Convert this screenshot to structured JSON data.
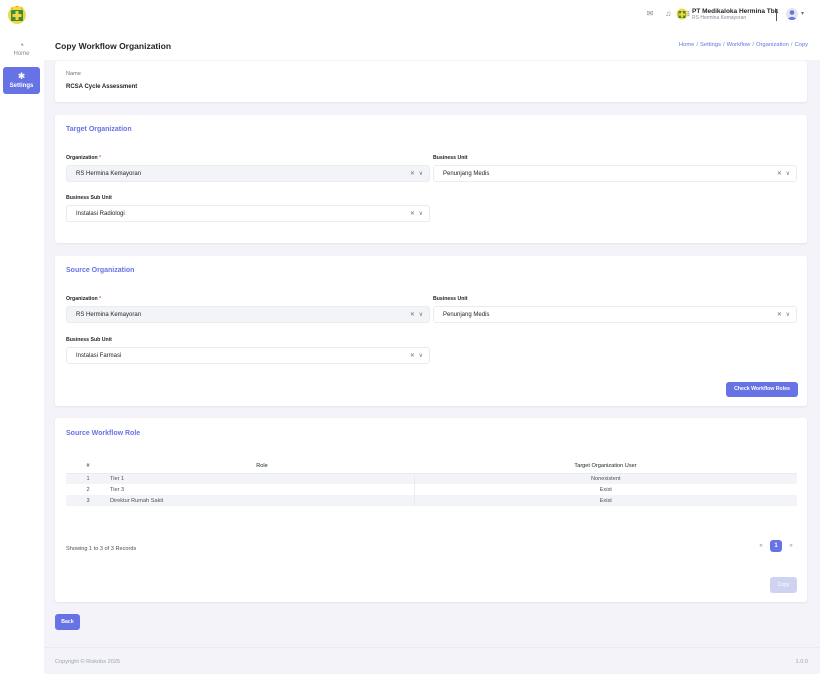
{
  "header": {
    "company_name": "PT Medikaloka Hermina Tbk",
    "company_sub": "RS Hermina Kemayoran",
    "icons": [
      "mail-icon",
      "bell-icon",
      "apps-grid-icon"
    ]
  },
  "sidebar": {
    "items": [
      {
        "label": "Home",
        "icon": "dashboard-icon"
      },
      {
        "label": "Settings",
        "icon": "gear-icon"
      }
    ]
  },
  "page": {
    "title": "Copy Workflow Organization",
    "breadcrumb": [
      "Home",
      "Settings",
      "Workflow",
      "Organization",
      "Copy"
    ]
  },
  "name_card": {
    "label": "Name",
    "value": "RCSA Cycle Assessment"
  },
  "target": {
    "title": "Target Organization",
    "organization_label": "Organization",
    "organization_value": "RS Hermina Kemayoran",
    "business_unit_label": "Business Unit",
    "business_unit_value": "Penunjang Medis",
    "sub_unit_label": "Business Sub Unit",
    "sub_unit_value": "Instalasi Radiologi"
  },
  "source": {
    "title": "Source Organization",
    "organization_label": "Organization",
    "organization_value": "RS Hermina Kemayoran",
    "business_unit_label": "Business Unit",
    "business_unit_value": "Penunjang Medis",
    "sub_unit_label": "Business Sub Unit",
    "sub_unit_value": "Instalasi Farmasi",
    "check_button": "Check Workflow Roles"
  },
  "roles": {
    "title": "Source Workflow Role",
    "columns": [
      "#",
      "Role",
      "Target Organization User"
    ],
    "rows": [
      {
        "num": "1",
        "role": "Tier 1",
        "status": "Nonexistent"
      },
      {
        "num": "2",
        "role": "Tier 3",
        "status": "Exist"
      },
      {
        "num": "3",
        "role": "Direktur Rumah Sakit",
        "status": "Exist"
      }
    ],
    "records_text": "Showing 1 to 3 of 3 Records",
    "pager": {
      "prev": "«",
      "current": "1",
      "next": "»"
    },
    "copy_button": "Copy"
  },
  "back_button": "Back",
  "footer": {
    "copyright": "Copyright © Riskobs 2025",
    "version": "1.0.0"
  },
  "colors": {
    "primary": "#6772e5",
    "danger": "#f06548",
    "success": "#45cb85"
  }
}
